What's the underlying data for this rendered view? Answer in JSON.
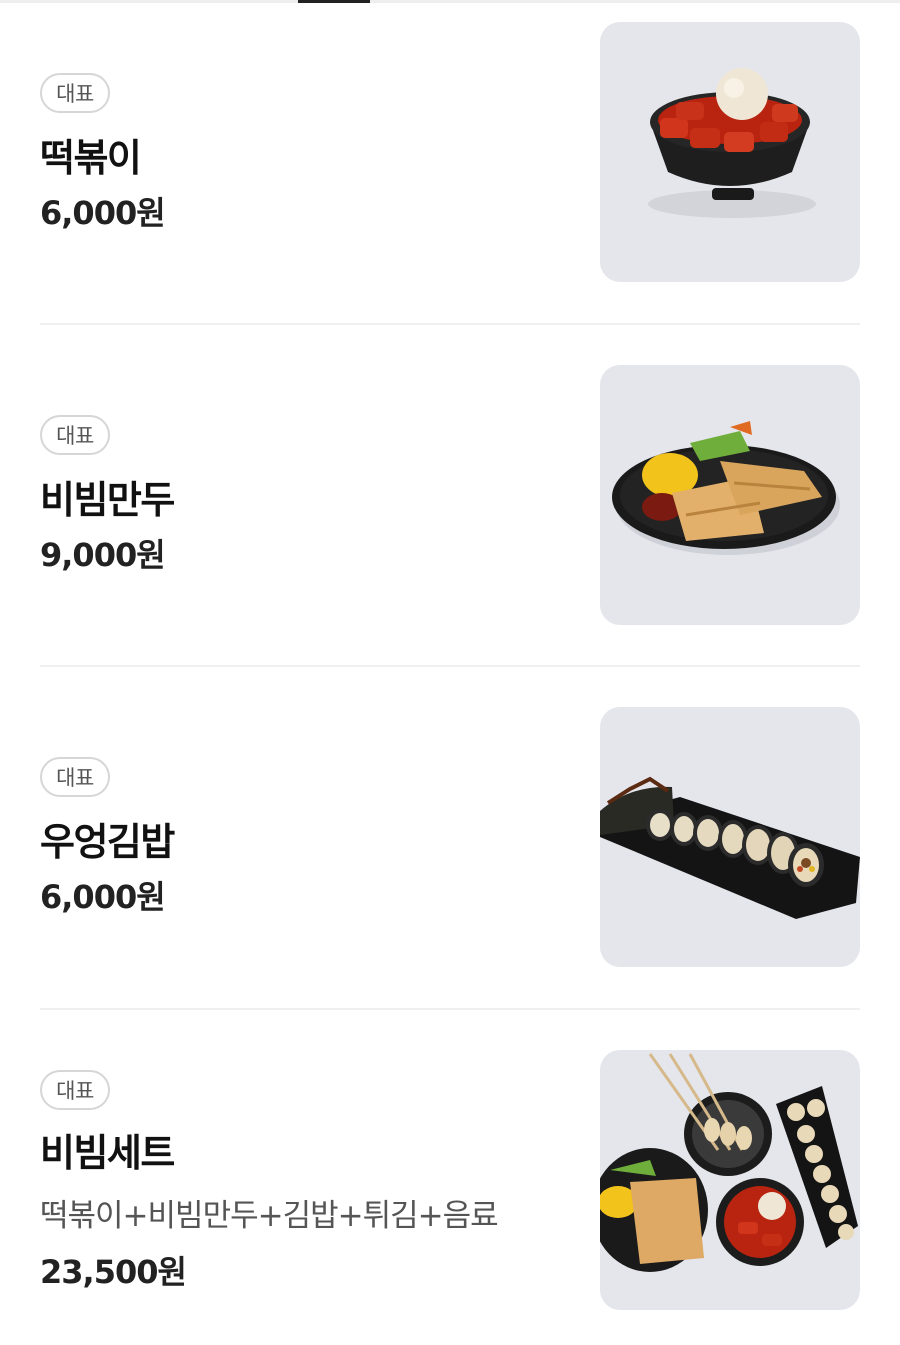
{
  "menu": {
    "items": [
      {
        "badge": "대표",
        "name": "떡볶이",
        "price": "6,000원",
        "image_icon": "tteokbokki-photo"
      },
      {
        "badge": "대표",
        "name": "비빔만두",
        "price": "9,000원",
        "image_icon": "bibim-mandu-photo"
      },
      {
        "badge": "대표",
        "name": "우엉김밥",
        "price": "6,000원",
        "image_icon": "burdock-gimbap-photo"
      },
      {
        "badge": "대표",
        "name": "비빔세트",
        "description": "떡볶이+비빔만두+김밥+튀김+음료",
        "price": "23,500원",
        "image_icon": "bibim-set-photo"
      }
    ]
  },
  "colors": {
    "background": "#ffffff",
    "text": "#111111",
    "badge_border": "#d6d6d6",
    "thumb_background": "#e4e6ec",
    "divider": "#f0f0f0"
  }
}
